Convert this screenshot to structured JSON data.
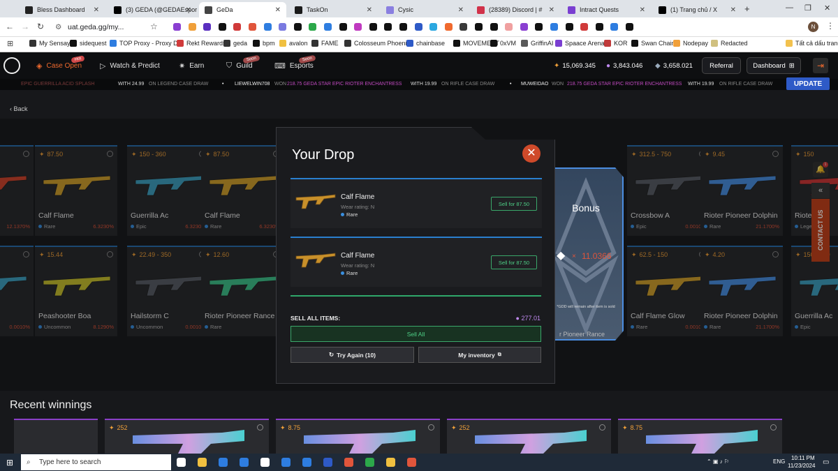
{
  "browser": {
    "tabs": [
      {
        "title": "Bless Dashboard",
        "color": "#222222"
      },
      {
        "title": "(3) GEDA (@GEDAEsports)",
        "color": "#000000"
      },
      {
        "title": "GeDa",
        "color": "#444444"
      },
      {
        "title": "TaskOn",
        "color": "#1a1a1a"
      },
      {
        "title": "Cysic",
        "color": "#8a7fe0"
      },
      {
        "title": "(28389) Discord | #",
        "color": "#d1324a"
      },
      {
        "title": "Intract Quests",
        "color": "#7a3fd1"
      },
      {
        "title": "(1) Trang chủ / X",
        "color": "#000000"
      }
    ],
    "url": "uat.geda.gg/my...",
    "profile_initial": "N",
    "bookmarks": [
      "My Sensay",
      "sidequest",
      "TOP Proxy - Proxy D...",
      "Rekt Rewards",
      "geda",
      "bpm",
      "avalon",
      "FAME",
      "Colosseum Phoenix",
      "chainbase",
      "MOVEMENT",
      "0xVM",
      "GriffinAI",
      "Spaace Arena",
      "KOR",
      "Swan Chain",
      "Nodepay",
      "Redacted"
    ],
    "bookmarks_all": "Tất cả dấu trang"
  },
  "nav": {
    "items": [
      "Case Open",
      "Watch & Predict",
      "Earn",
      "Guild",
      "Esports"
    ],
    "badges": {
      "case_open": "Hot",
      "guild": "Soon",
      "esports": "Soon"
    },
    "balance_orange": "15,069.345",
    "balance_purple": "3,843.046",
    "balance_eth": "3,658.021",
    "referral": "Referral",
    "dashboard": "Dashboard"
  },
  "ticker": [
    {
      "text": "EPIC GUERRILLA ACID SPLASH",
      "with": "WITH 24.99",
      "on": "ON LEGEND CASE DRAW"
    },
    {
      "user": "LIEWELWIN708",
      "won": "WON",
      "text": "218.75 GEDA STAR EPIC RIOTER ENCHANTRESS",
      "with": "WITH 19.99",
      "on": "ON RIFLE CASE DRAW"
    },
    {
      "user": "MUWEIDAO",
      "won": "WON",
      "text": "218.75 GEDA STAR EPIC RIOTER ENCHANTRESS",
      "with": "WITH 19.99",
      "on": "ON RIFLE CASE DRAW"
    }
  ],
  "update_label": "UPDATE",
  "back_label": "Back",
  "cards_row1": [
    {
      "price": "",
      "name": "oberry",
      "rarity": "",
      "pct": "12.1370%",
      "color": "#d0452e"
    },
    {
      "price": "87.50",
      "name": "Calf Flame",
      "rarity": "Rare",
      "pct": "6.3230%",
      "color": "#d0a02e"
    },
    {
      "price": "150 - 360",
      "name": "Guerrilla Ac",
      "rarity": "Epic",
      "pct": "6.3230%",
      "color": "#3fa0c0"
    },
    {
      "price": "87.50",
      "name": "Calf Flame",
      "rarity": "Rare",
      "pct": "6.3230%",
      "color": "#d0a02e"
    },
    {
      "price": "312.5 - 750",
      "name": "Crossbow A",
      "rarity": "Epic",
      "pct": "0.0010%",
      "color": "#5a5f68"
    },
    {
      "price": "9.45",
      "name": "Rioter Pioneer Dolphin",
      "rarity": "Rare",
      "pct": "21.1700%",
      "color": "#4a8fe0"
    },
    {
      "price": "150",
      "name": "Riote",
      "rarity": "Lege",
      "pct": "",
      "color": "#d03a3a"
    }
  ],
  "cards_row2": [
    {
      "price": "",
      "name": "",
      "rarity": "",
      "pct": "0.0010%",
      "color": "#3fa0c0"
    },
    {
      "price": "15.44",
      "name": "Peashooter Boa",
      "rarity": "Uncommon",
      "pct": "8.1290%",
      "color": "#c8c030"
    },
    {
      "price": "22.49 - 350",
      "name": "Hailstorm C",
      "rarity": "Uncommon",
      "pct": "0.0010%",
      "color": "#5a5f68"
    },
    {
      "price": "12.60",
      "name": "Rioter Pioneer Rance",
      "rarity": "Rare",
      "pct": "",
      "color": "#3fc08a"
    },
    {
      "price": "62.5 - 150",
      "name": "Calf Flame Glow",
      "rarity": "Rare",
      "pct": "0.0010%",
      "color": "#d0a02e"
    },
    {
      "price": "4.20",
      "name": "Rioter Pioneer Dolphin",
      "rarity": "Rare",
      "pct": "21.1700%",
      "color": "#4a8fe0"
    },
    {
      "price": "150 - 360",
      "name": "Guerrilla Ac",
      "rarity": "Epic",
      "pct": "",
      "color": "#3fa0c0"
    }
  ],
  "recent": {
    "title": "Recent winnings",
    "prices": [
      "252",
      "8.75",
      "252",
      "8.75"
    ]
  },
  "contact_label": "CONTACT US",
  "bell_count": "1",
  "modal": {
    "title": "Your Drop",
    "drops": [
      {
        "name": "Calf Flame",
        "wear": "Wear rating: N",
        "rarity": "Rare",
        "sell": "Sell for 87.50"
      },
      {
        "name": "Calf Flame",
        "wear": "Wear rating: N",
        "rarity": "Rare",
        "sell": "Sell for 87.50"
      }
    ],
    "sell_all_label": "SELL ALL ITEMS:",
    "sell_all_total": "277.01",
    "sell_all_button": "Sell All",
    "try_again": "Try Again (10)",
    "my_inventory": "My inventory"
  },
  "bonus": {
    "title": "Bonus",
    "value": "11.0366",
    "note": "*GDD will remain after item is sold",
    "under_text": "r Pioneer Rance",
    "under_pct": "21.1700%"
  },
  "taskbar": {
    "search": "Type here to search",
    "lang": "ENG",
    "time": "10:11 PM",
    "date": "11/23/2024"
  }
}
